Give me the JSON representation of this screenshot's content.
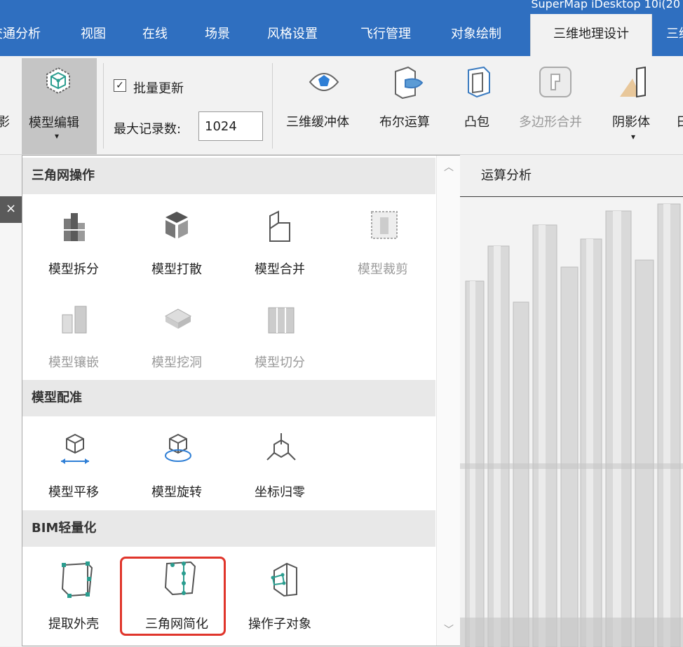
{
  "app": {
    "title": "SuperMap iDesktop 10i(20"
  },
  "tabs": [
    {
      "label": "交通分析"
    },
    {
      "label": "视图"
    },
    {
      "label": "在线"
    },
    {
      "label": "场景"
    },
    {
      "label": "风格设置"
    },
    {
      "label": "飞行管理"
    },
    {
      "label": "对象绘制"
    },
    {
      "label": "三维地理设计",
      "active": true
    },
    {
      "label": "三维"
    }
  ],
  "ribbon": {
    "left_partial_label": "影",
    "model_edit": {
      "label": "模型编辑",
      "dropdown_arrow": "▾"
    },
    "batch_update": {
      "label": "批量更新",
      "checked": true,
      "check_mark": "☑"
    },
    "max_records": {
      "label": "最大记录数:",
      "value": "1024"
    },
    "buttons": [
      {
        "label": "三维缓冲体",
        "icon": "buffer-icon"
      },
      {
        "label": "布尔运算",
        "icon": "boolean-icon"
      },
      {
        "label": "凸包",
        "icon": "convex-hull-icon"
      },
      {
        "label": "多边形合并",
        "icon": "polygon-merge-icon",
        "disabled": true
      },
      {
        "label": "阴影体",
        "icon": "shadow-volume-icon",
        "dropdown_arrow": "▾"
      },
      {
        "label": "日"
      }
    ],
    "group_label": "运算分析"
  },
  "close_tab": "×",
  "dropdown": {
    "sections": [
      {
        "header": "三角网操作",
        "items": [
          {
            "label": "模型拆分",
            "icon": "model-split-icon"
          },
          {
            "label": "模型打散",
            "icon": "model-explode-icon"
          },
          {
            "label": "模型合并",
            "icon": "model-merge-icon"
          },
          {
            "label": "模型裁剪",
            "icon": "model-clip-icon",
            "disabled": true
          },
          {
            "label": "模型镶嵌",
            "icon": "model-mosaic-icon",
            "disabled": true
          },
          {
            "label": "模型挖洞",
            "icon": "model-hole-icon",
            "disabled": true
          },
          {
            "label": "模型切分",
            "icon": "model-cut-icon",
            "disabled": true
          }
        ]
      },
      {
        "header": "模型配准",
        "items": [
          {
            "label": "模型平移",
            "icon": "model-translate-icon"
          },
          {
            "label": "模型旋转",
            "icon": "model-rotate-icon"
          },
          {
            "label": "坐标归零",
            "icon": "coordinate-zero-icon"
          }
        ]
      },
      {
        "header": "BIM轻量化",
        "items": [
          {
            "label": "提取外壳",
            "icon": "extract-shell-icon"
          },
          {
            "label": "三角网简化",
            "icon": "mesh-simplify-icon",
            "highlighted": true
          },
          {
            "label": "操作子对象",
            "icon": "sub-object-icon"
          }
        ]
      }
    ],
    "scroll_up": "︿",
    "scroll_down": "﹀"
  },
  "colors": {
    "accent": "#2f6fc0",
    "highlight": "#e0352b",
    "teal": "#2a9d8f"
  }
}
